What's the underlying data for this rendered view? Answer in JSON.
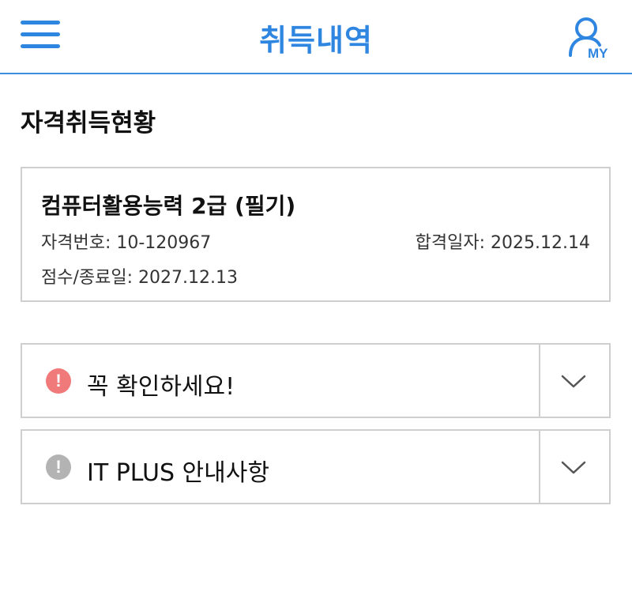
{
  "header": {
    "title": "취득내역",
    "menu_icon": "hamburger-menu-icon",
    "my_icon": "user-my-icon",
    "my_label": "MY",
    "accent_color": "#2f86e0"
  },
  "section": {
    "title": "자격취득현황"
  },
  "certificate": {
    "name": "컴퓨터활용능력 2급 (필기)",
    "number_label": "자격번호: 10-120967",
    "pass_date_label": "합격일자: 2025.12.14",
    "expiry_label": "점수/종료일: 2027.12.13"
  },
  "accordions": [
    {
      "label": "꼭 확인하세요!",
      "icon": "alert-icon",
      "icon_glyph": "!",
      "icon_color": "#f07a7a",
      "chevron": "chevron-down-icon"
    },
    {
      "label": "IT PLUS 안내사항",
      "icon": "info-alert-icon",
      "icon_glyph": "!",
      "icon_color": "#b3b3b3",
      "chevron": "chevron-down-icon"
    }
  ]
}
